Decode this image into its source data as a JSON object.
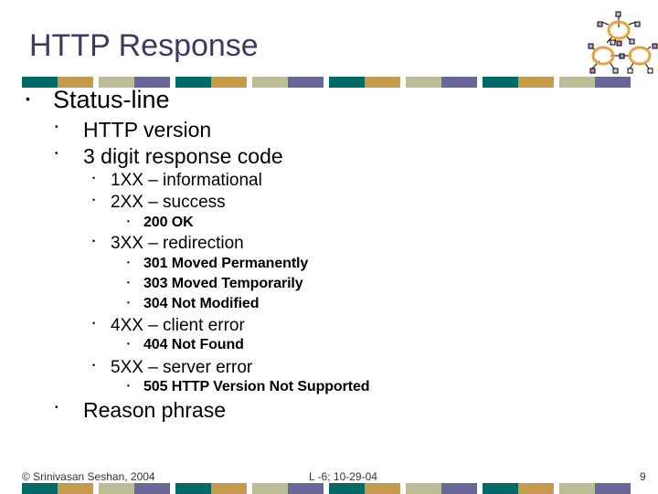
{
  "slide": {
    "title": "HTTP Response",
    "bullets": [
      {
        "level": 1,
        "text": "Status-line"
      },
      {
        "level": 2,
        "text": "HTTP version"
      },
      {
        "level": 2,
        "text": "3 digit response code"
      },
      {
        "level": 3,
        "text": "1XX – informational"
      },
      {
        "level": 3,
        "text": "2XX – success"
      },
      {
        "level": 4,
        "text": "200 OK"
      },
      {
        "level": 3,
        "text": "3XX – redirection"
      },
      {
        "level": 4,
        "text": "301 Moved Permanently"
      },
      {
        "level": 4,
        "text": "303 Moved Temporarily"
      },
      {
        "level": 4,
        "text": "304 Not Modified"
      },
      {
        "level": 3,
        "text": "4XX – client error"
      },
      {
        "level": 4,
        "text": "404 Not Found"
      },
      {
        "level": 3,
        "text": "5XX – server error"
      },
      {
        "level": 4,
        "text": "505 HTTP Version Not Supported"
      },
      {
        "level": 2,
        "text": "Reason phrase"
      }
    ],
    "bullet_glyph": "•"
  },
  "footer": {
    "copyright": "© Srinivasan Seshan, 2004",
    "lecture": "L -6; 10-29-04",
    "page_number": "9"
  },
  "theme": {
    "title_color": "#3c3a62",
    "bar_colors": [
      "#006a66",
      "#c69c4c",
      "#babd95",
      "#676898"
    ],
    "logo_ring_color": "#e6a43c"
  },
  "logo_icon": "network-rings-icon"
}
